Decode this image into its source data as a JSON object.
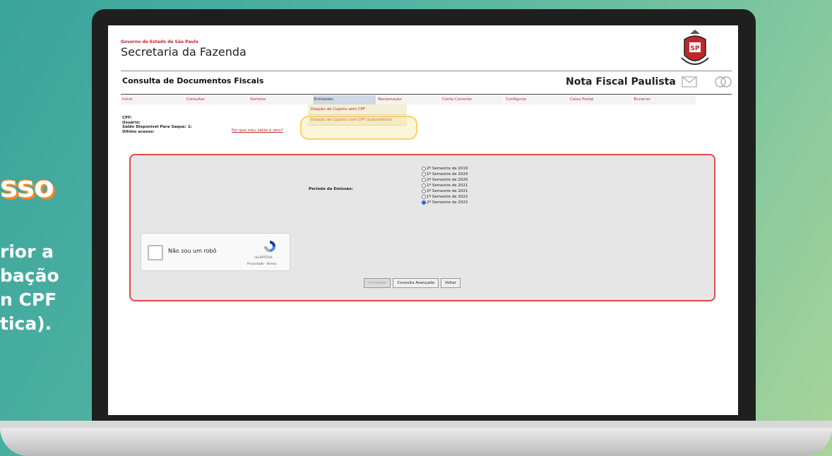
{
  "promo": {
    "step_fragment": "sso",
    "lines": [
      "rior a",
      "bação",
      "n CPF",
      "tica)."
    ]
  },
  "header": {
    "gov_label": "Governo do Estado de São Paulo",
    "secretaria": "Secretaria da Fazenda",
    "page_title": "Consulta de Documentos Fiscais",
    "nfp_title": "Nota Fiscal Paulista"
  },
  "menu": {
    "items": [
      "Início",
      "Consultar",
      "Sorteios",
      "Entidades",
      "Reclamação",
      "Conta Corrente",
      "Configurar",
      "Caixa Postal",
      "Encerrar"
    ]
  },
  "dropdown": {
    "items": [
      "Doação de Cupons sem CPF",
      "Doação de Cupons com CPF (automática)"
    ]
  },
  "info": {
    "cpf_label": "CPF:",
    "usuario_label": "Usuário:",
    "saldo_label": "Saldo Disponível Para Saque: 1:",
    "ultimo_acesso_label": "Último acesso:",
    "saldo_link": "Por que meu saldo é zero?"
  },
  "form": {
    "periodo_label": "Período de Emissão:",
    "periods": [
      {
        "label": "2º Semestre de 2019",
        "selected": false
      },
      {
        "label": "1º Semestre de 2020",
        "selected": false
      },
      {
        "label": "2º Semestre de 2020",
        "selected": false
      },
      {
        "label": "1º Semestre de 2021",
        "selected": false
      },
      {
        "label": "2º Semestre de 2021",
        "selected": false
      },
      {
        "label": "1º Semestre de 2022",
        "selected": false
      },
      {
        "label": "2º Semestre de 2022",
        "selected": true
      }
    ],
    "captcha_label": "Não sou um robô",
    "captcha_brand": "reCAPTCHA",
    "captcha_links": "Privacidade - Termos",
    "buttons": {
      "consultar": "Consultar",
      "consulta_avancada": "Consulta Avançada",
      "voltar": "Voltar"
    }
  },
  "colors": {
    "accent_red": "#c0272d",
    "panel_border": "#e04a4a",
    "highlight": "#f5d36b"
  }
}
